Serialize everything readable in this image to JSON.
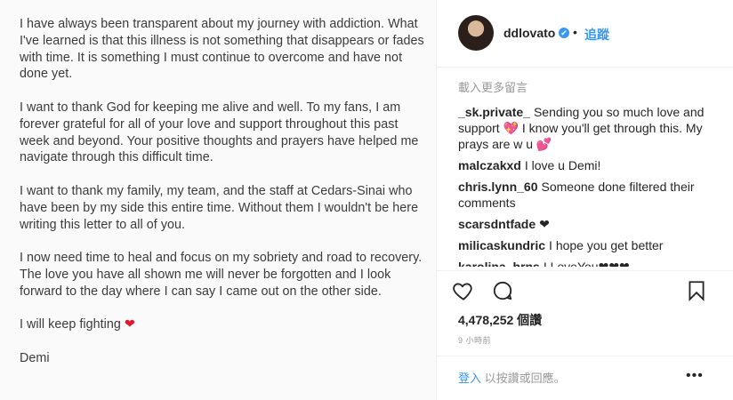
{
  "letter": {
    "paragraphs": [
      "I have always been transparent about my journey with addiction. What I've learned is that this illness is not something that disappears or fades with time.  It is something I must continue to overcome and have not done yet.",
      "I want to thank God for keeping me alive and well. To my fans, I am forever grateful for all of your love and support throughout this past week and beyond. Your positive thoughts and prayers have helped me navigate through this difficult time.",
      "I want to thank my family, my team, and the staff at Cedars-Sinai who have been by my side this entire time. Without them I wouldn't be here writing this letter to all of you.",
      "I now need time to heal and focus on my sobriety and road to recovery. The love you have all shown me will never be forgotten and I look forward to the day where I can say I came out on the other side."
    ],
    "closing": "I will keep fighting",
    "closing_emoji": "❤",
    "signature": "Demi"
  },
  "header": {
    "username": "ddlovato",
    "verified_icon": "✔",
    "separator": "•",
    "follow_label": "追蹤"
  },
  "comments_panel": {
    "load_more": "載入更多留言",
    "comments": [
      {
        "user": "_sk.private_",
        "text": "Sending you so much love and support 💖 I know you'll get through this. My prays are w u 💕"
      },
      {
        "user": "malczakxd",
        "text": "I love u Demi!"
      },
      {
        "user": "chris.lynn_60",
        "text": "Someone done filtered their comments"
      },
      {
        "user": "scarsdntfade",
        "text": "❤"
      },
      {
        "user": "milicaskundric",
        "text": "I hope you get better"
      },
      {
        "user": "karolina_hrns",
        "text": "I LoveYou❤❤❤"
      }
    ]
  },
  "post": {
    "likes": "4,478,252 個讚",
    "time": "9 小時前"
  },
  "footer": {
    "login_link": "登入",
    "login_rest": " 以按讚或回應。",
    "more_label": "•••"
  },
  "colors": {
    "link": "#3897f0",
    "muted": "#999999",
    "heart": "#e0182d"
  }
}
